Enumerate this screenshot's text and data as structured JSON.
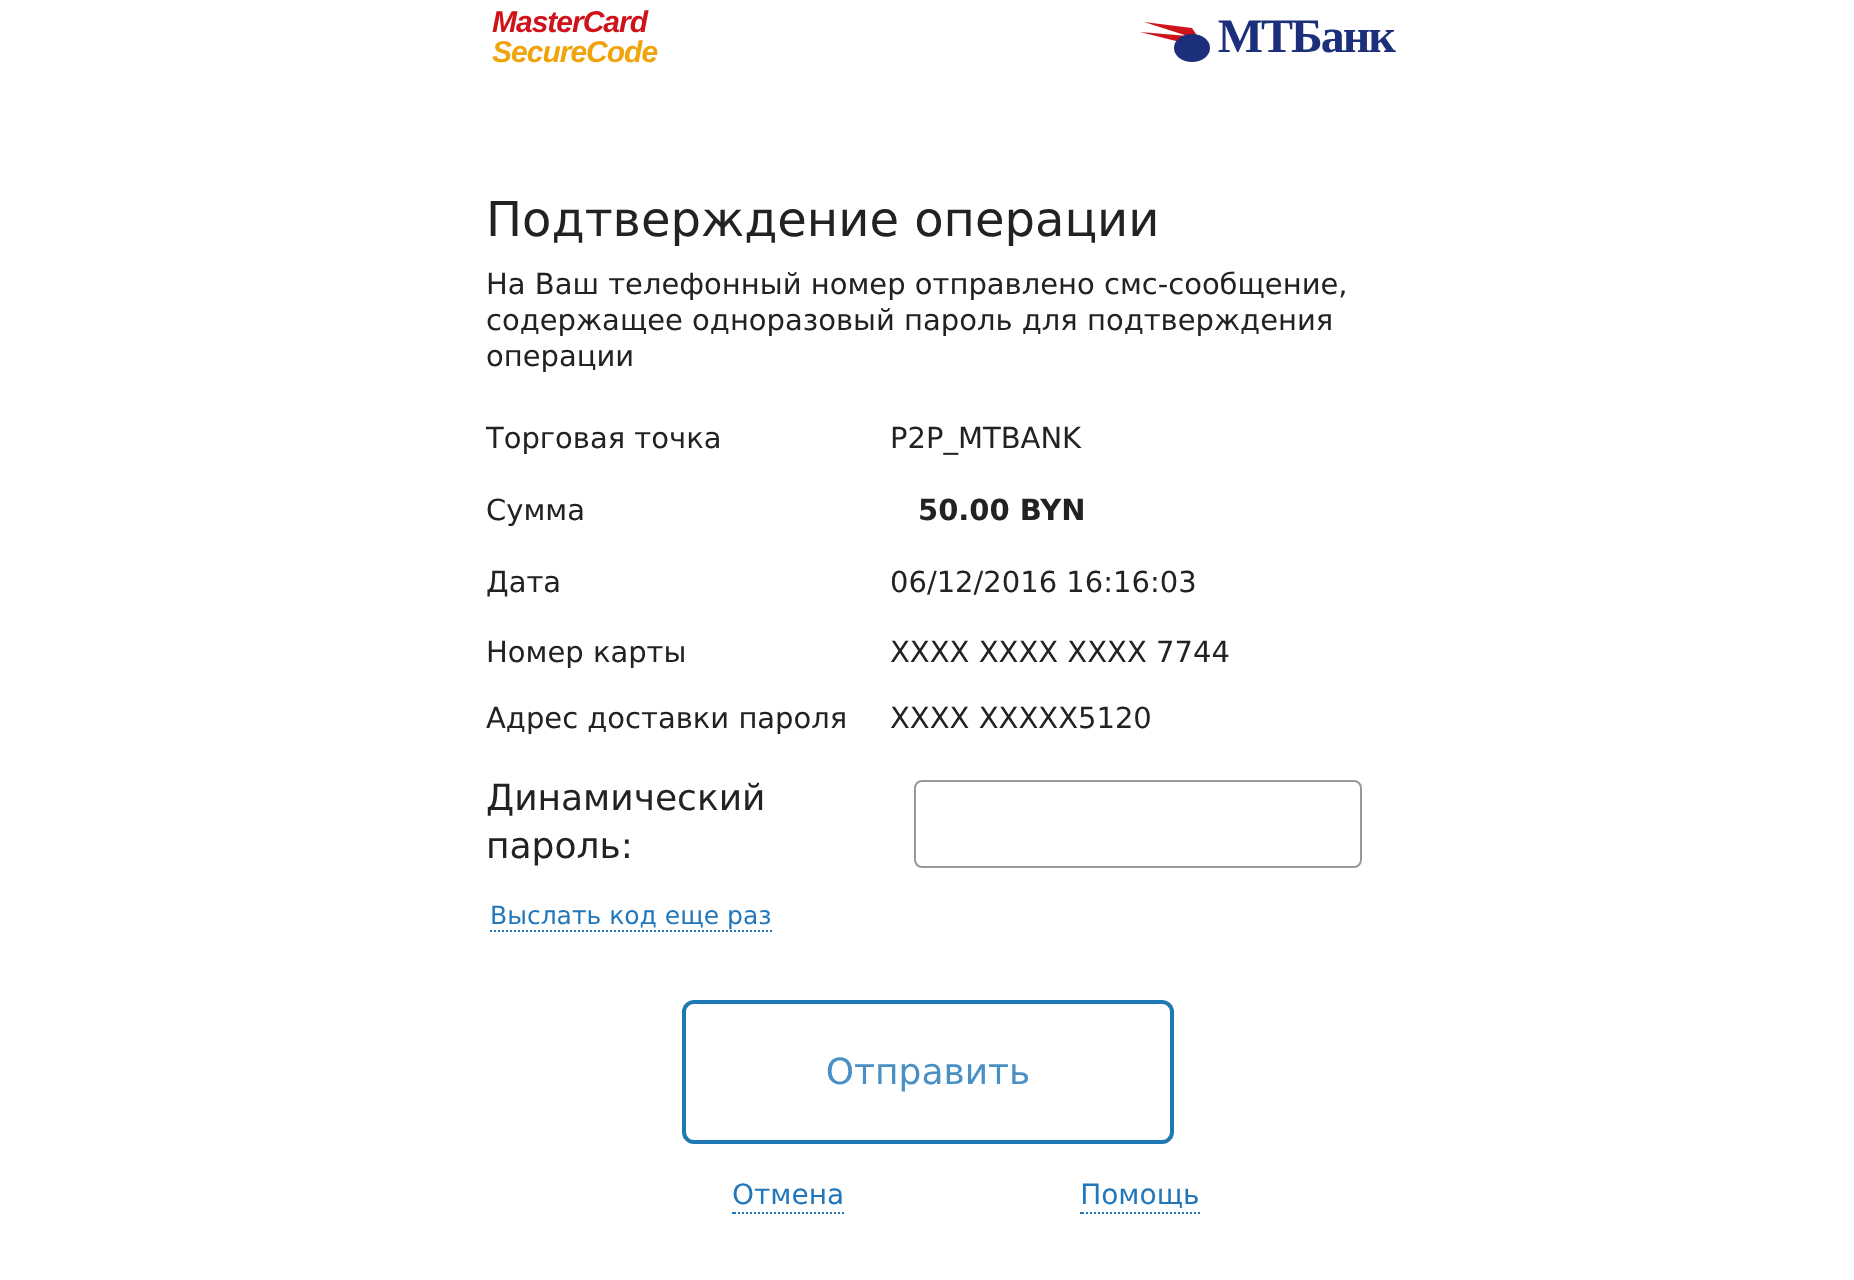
{
  "header": {
    "card_logo": {
      "line_1": "MasterCard",
      "line_2": "SecureCode"
    },
    "bank_logo": {
      "text": "МТБанк"
    }
  },
  "title": "Подтверждение операции",
  "description": "На Ваш телефонный номер отправлено смс-сообщение, содержащее одноразовый пароль для подтверждения операции",
  "details": [
    {
      "label": "Торговая точка",
      "value": "P2P_MTBANK",
      "bold": false
    },
    {
      "label": "Сумма",
      "value": "50.00 BYN",
      "bold": true
    },
    {
      "label": "Дата",
      "value": "06/12/2016 16:16:03",
      "bold": false
    },
    {
      "label": "Номер карты",
      "value": "XXXX XXXX XXXX 7744",
      "bold": false
    },
    {
      "label": "Адрес доставки пароля",
      "value": "XXXX XXXXX5120",
      "bold": false
    }
  ],
  "password": {
    "label": "Динамический пароль:"
  },
  "resend_link": "Выслать код еще раз",
  "submit_button": "Отправить",
  "footer_links": [
    "Отмена",
    "Помощь"
  ]
}
